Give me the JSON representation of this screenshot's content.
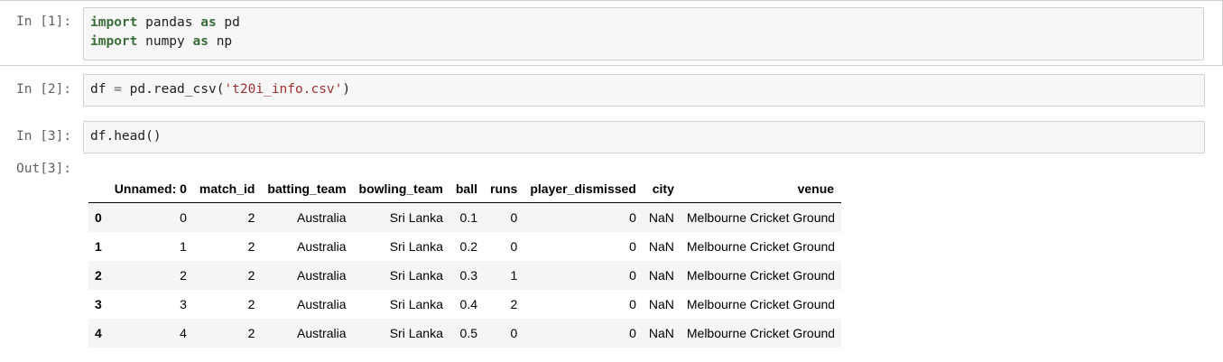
{
  "cells": [
    {
      "prompt": "In [1]:",
      "lines": [
        [
          {
            "t": "kw",
            "v": "import"
          },
          {
            "t": "plain",
            "v": " pandas "
          },
          {
            "t": "kw",
            "v": "as"
          },
          {
            "t": "plain",
            "v": " pd"
          }
        ],
        [
          {
            "t": "kw",
            "v": "import"
          },
          {
            "t": "plain",
            "v": " numpy "
          },
          {
            "t": "kw",
            "v": "as"
          },
          {
            "t": "plain",
            "v": " np"
          }
        ]
      ]
    },
    {
      "prompt": "In [2]:",
      "lines": [
        [
          {
            "t": "plain",
            "v": "df "
          },
          {
            "t": "op",
            "v": "="
          },
          {
            "t": "plain",
            "v": " pd.read_csv("
          },
          {
            "t": "str",
            "v": "'t20i_info.csv'"
          },
          {
            "t": "plain",
            "v": ")"
          }
        ]
      ]
    },
    {
      "prompt": "In [3]:",
      "lines": [
        [
          {
            "t": "plain",
            "v": "df.head()"
          }
        ]
      ]
    }
  ],
  "output": {
    "prompt": "Out[3]:",
    "columns": [
      "",
      "Unnamed: 0",
      "match_id",
      "batting_team",
      "bowling_team",
      "ball",
      "runs",
      "player_dismissed",
      "city",
      "venue"
    ],
    "rows": [
      [
        "0",
        "0",
        "2",
        "Australia",
        "Sri Lanka",
        "0.1",
        "0",
        "0",
        "NaN",
        "Melbourne Cricket Ground"
      ],
      [
        "1",
        "1",
        "2",
        "Australia",
        "Sri Lanka",
        "0.2",
        "0",
        "0",
        "NaN",
        "Melbourne Cricket Ground"
      ],
      [
        "2",
        "2",
        "2",
        "Australia",
        "Sri Lanka",
        "0.3",
        "1",
        "0",
        "NaN",
        "Melbourne Cricket Ground"
      ],
      [
        "3",
        "3",
        "2",
        "Australia",
        "Sri Lanka",
        "0.4",
        "2",
        "0",
        "NaN",
        "Melbourne Cricket Ground"
      ],
      [
        "4",
        "4",
        "2",
        "Australia",
        "Sri Lanka",
        "0.5",
        "0",
        "0",
        "NaN",
        "Melbourne Cricket Ground"
      ]
    ]
  }
}
